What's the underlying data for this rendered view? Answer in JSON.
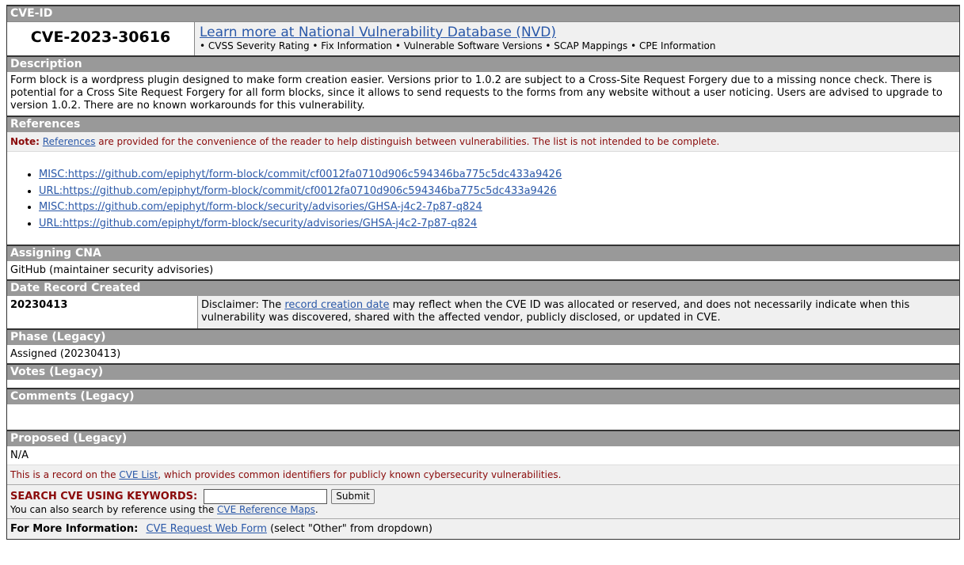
{
  "cve_id": {
    "header": "CVE-ID",
    "value": "CVE-2023-30616",
    "nvd_link": "Learn more at National Vulnerability Database (NVD)",
    "nvd_sub": "• CVSS Severity Rating • Fix Information • Vulnerable Software Versions • SCAP Mappings • CPE Information"
  },
  "description": {
    "header": "Description",
    "text": "Form block is a wordpress plugin designed to make form creation easier. Versions prior to 1.0.2 are subject to a Cross-Site Request Forgery due to a missing nonce check. There is potential for a Cross Site Request Forgery for all form blocks, since it allows to send requests to the forms from any website without a user noticing. Users are advised to upgrade to version 1.0.2. There are no known workarounds for this vulnerability."
  },
  "references": {
    "header": "References",
    "note_label": "Note:",
    "note_link": "References",
    "note_text": " are provided for the convenience of the reader to help distinguish between vulnerabilities. The list is not intended to be complete.",
    "items": [
      "MISC:https://github.com/epiphyt/form-block/commit/cf0012fa0710d906c594346ba775c5dc433a9426",
      "URL:https://github.com/epiphyt/form-block/commit/cf0012fa0710d906c594346ba775c5dc433a9426",
      "MISC:https://github.com/epiphyt/form-block/security/advisories/GHSA-j4c2-7p87-q824",
      "URL:https://github.com/epiphyt/form-block/security/advisories/GHSA-j4c2-7p87-q824"
    ]
  },
  "assigning_cna": {
    "header": "Assigning CNA",
    "value": "GitHub (maintainer security advisories)"
  },
  "date_record_created": {
    "header": "Date Record Created",
    "value": "20230413",
    "disclaimer_prefix": "Disclaimer: The ",
    "disclaimer_link": "record creation date",
    "disclaimer_suffix": " may reflect when the CVE ID was allocated or reserved, and does not necessarily indicate when this vulnerability was discovered, shared with the affected vendor, publicly disclosed, or updated in CVE."
  },
  "phase": {
    "header": "Phase (Legacy)",
    "value": "Assigned (20230413)"
  },
  "votes": {
    "header": "Votes (Legacy)"
  },
  "comments": {
    "header": "Comments (Legacy)"
  },
  "proposed": {
    "header": "Proposed (Legacy)",
    "value": "N/A"
  },
  "footer": {
    "record_prefix": "This is a record on the ",
    "record_link": "CVE List",
    "record_suffix": ", which provides common identifiers for publicly known cybersecurity vulnerabilities.",
    "search_label": "SEARCH CVE USING KEYWORDS:",
    "search_value": "",
    "submit_label": "Submit",
    "search_sub_prefix": "You can also search by reference using the ",
    "search_sub_link": "CVE Reference Maps",
    "search_sub_suffix": ".",
    "more_info_label": "For More Information:",
    "more_info_link": "CVE Request Web Form",
    "more_info_suffix": " (select \"Other\" from dropdown)"
  },
  "colors": {
    "header_bg": "#999999",
    "link": "#2a58a8",
    "note_text": "#8a0a0a",
    "panel_bg": "#f0f0f0"
  }
}
